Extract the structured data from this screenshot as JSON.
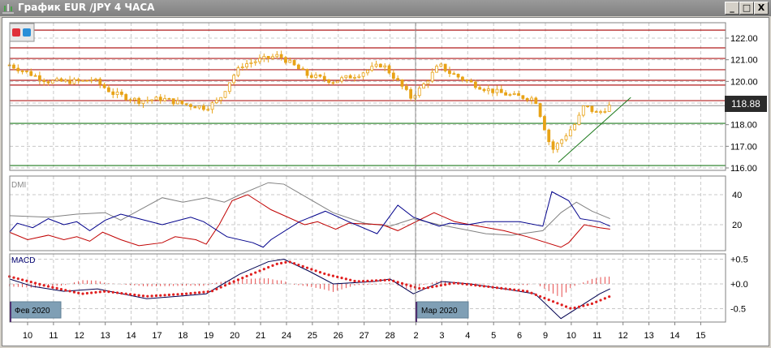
{
  "window": {
    "title": "График EUR /JPY  4 ЧАСА",
    "minimize": "_",
    "maximize": "□",
    "close": "X"
  },
  "colors": {
    "candle": "#e8a317",
    "resistance": "#b01c1c",
    "support": "#1d7a1d",
    "plus_di": "#00008b",
    "minus_di": "#c00000",
    "adx": "#808080",
    "macd": "#000050",
    "signal": "#e02020",
    "month_label_bg": "#7f9fb5",
    "price_tag_bg": "#2b2b2b"
  },
  "price_axis": {
    "ticks": [
      "122.00",
      "121.00",
      "120.00",
      "119.00",
      "118.00",
      "117.00",
      "116.00"
    ],
    "current_price": "118.88"
  },
  "dmi": {
    "label": "DMI",
    "ticks": [
      "40",
      "20"
    ]
  },
  "macd": {
    "label": "MACD",
    "ticks": [
      "+0.5",
      "+0.0",
      "-0.5"
    ]
  },
  "month_labels": [
    "Фев 2020",
    "Мар 2020"
  ],
  "date_ticks": [
    "10",
    "11",
    "12",
    "13",
    "14",
    "17",
    "18",
    "19",
    "20",
    "21",
    "24",
    "25",
    "26",
    "27",
    "28",
    "2",
    "3",
    "4",
    "5",
    "6",
    "9",
    "10",
    "11",
    "12",
    "13",
    "14",
    "15"
  ],
  "chart_data": {
    "type": "line",
    "title": "EUR/JPY 4H",
    "x_unit": "trading-day index (0 = 10 Feb)",
    "price": {
      "ylim": [
        115.8,
        122.6
      ],
      "close": [
        [
          -0.7,
          120.76
        ],
        [
          0.2,
          120.3
        ],
        [
          0.8,
          120.0
        ],
        [
          2.1,
          120.0
        ],
        [
          2.5,
          120.1
        ],
        [
          3.3,
          119.45
        ],
        [
          4.3,
          119.1
        ],
        [
          5.2,
          119.2
        ],
        [
          6.0,
          118.96
        ],
        [
          6.9,
          118.78
        ],
        [
          7.4,
          119.15
        ],
        [
          7.9,
          120.2
        ],
        [
          8.3,
          120.76
        ],
        [
          9.0,
          121.0
        ],
        [
          9.7,
          121.2
        ],
        [
          10.2,
          120.8
        ],
        [
          10.8,
          120.3
        ],
        [
          11.8,
          120.0
        ],
        [
          12.7,
          120.3
        ],
        [
          13.7,
          120.8
        ],
        [
          14.3,
          120.0
        ],
        [
          14.8,
          119.26
        ],
        [
          15.2,
          119.7
        ],
        [
          15.9,
          120.76
        ],
        [
          16.3,
          120.4
        ],
        [
          17.0,
          120.0
        ],
        [
          17.7,
          119.64
        ],
        [
          18.7,
          119.34
        ],
        [
          19.6,
          119.2
        ],
        [
          19.9,
          118.1
        ],
        [
          20.25,
          116.8
        ],
        [
          20.7,
          117.4
        ],
        [
          21.2,
          118.1
        ],
        [
          21.5,
          118.9
        ],
        [
          22.0,
          118.5
        ],
        [
          22.5,
          118.88
        ]
      ],
      "resistance_levels": [
        122.37,
        121.55,
        121.06,
        120.54,
        120.05,
        119.83,
        119.11
      ],
      "support_levels": [
        118.06,
        116.11
      ],
      "trendline": [
        [
          20.5,
          116.26
        ],
        [
          23.3,
          119.26
        ]
      ]
    },
    "dmi": {
      "ylim": [
        3,
        50
      ],
      "adx": [
        [
          -0.7,
          26
        ],
        [
          0.8,
          25
        ],
        [
          1.9,
          27
        ],
        [
          3.0,
          28
        ],
        [
          3.6,
          23
        ],
        [
          5.2,
          38
        ],
        [
          6.0,
          35
        ],
        [
          6.9,
          38
        ],
        [
          7.6,
          35
        ],
        [
          8.2,
          40
        ],
        [
          9.3,
          48
        ],
        [
          9.9,
          47
        ],
        [
          10.8,
          38
        ],
        [
          11.8,
          28
        ],
        [
          13.0,
          21
        ],
        [
          14.0,
          19
        ],
        [
          14.9,
          24
        ],
        [
          15.9,
          20
        ],
        [
          16.8,
          17
        ],
        [
          17.7,
          14
        ],
        [
          18.7,
          13
        ],
        [
          19.9,
          16
        ],
        [
          20.6,
          28
        ],
        [
          21.2,
          35
        ],
        [
          21.8,
          29
        ],
        [
          22.5,
          24
        ]
      ],
      "plus_di": [
        [
          -0.7,
          15
        ],
        [
          -0.4,
          21
        ],
        [
          0.2,
          18
        ],
        [
          0.8,
          24
        ],
        [
          1.4,
          20
        ],
        [
          1.9,
          22
        ],
        [
          2.4,
          16
        ],
        [
          3.0,
          23
        ],
        [
          3.6,
          27
        ],
        [
          4.3,
          24
        ],
        [
          5.2,
          20
        ],
        [
          6.3,
          25
        ],
        [
          6.8,
          22
        ],
        [
          7.7,
          12
        ],
        [
          8.7,
          8
        ],
        [
          9.1,
          5
        ],
        [
          9.4,
          10
        ],
        [
          10.5,
          22
        ],
        [
          11.5,
          29
        ],
        [
          12.4,
          22
        ],
        [
          13.5,
          14
        ],
        [
          14.3,
          33
        ],
        [
          14.9,
          25
        ],
        [
          15.9,
          19
        ],
        [
          16.3,
          21
        ],
        [
          17.0,
          20
        ],
        [
          17.7,
          22
        ],
        [
          19.0,
          22
        ],
        [
          19.9,
          19
        ],
        [
          20.25,
          42
        ],
        [
          20.9,
          36
        ],
        [
          21.35,
          24
        ],
        [
          22.1,
          22
        ],
        [
          22.5,
          19
        ]
      ],
      "minus_di": [
        [
          -0.7,
          15
        ],
        [
          0.0,
          10
        ],
        [
          0.8,
          13
        ],
        [
          1.4,
          10
        ],
        [
          1.9,
          12
        ],
        [
          2.4,
          9
        ],
        [
          2.9,
          15
        ],
        [
          3.6,
          10
        ],
        [
          4.3,
          6
        ],
        [
          5.2,
          8
        ],
        [
          5.7,
          12
        ],
        [
          6.5,
          10
        ],
        [
          6.9,
          7
        ],
        [
          7.4,
          20
        ],
        [
          7.9,
          36
        ],
        [
          8.5,
          40
        ],
        [
          9.4,
          30
        ],
        [
          10.7,
          20
        ],
        [
          11.2,
          22
        ],
        [
          11.9,
          17
        ],
        [
          12.4,
          21
        ],
        [
          13.7,
          20
        ],
        [
          14.3,
          16
        ],
        [
          15.7,
          28
        ],
        [
          16.5,
          22
        ],
        [
          17.1,
          20
        ],
        [
          18.4,
          16
        ],
        [
          19.3,
          12
        ],
        [
          20.6,
          5
        ],
        [
          20.9,
          8
        ],
        [
          21.5,
          20
        ],
        [
          22.1,
          18
        ],
        [
          22.5,
          17
        ]
      ]
    },
    "macd": {
      "ylim": [
        -0.75,
        0.6
      ],
      "main": [
        [
          -0.7,
          0.1
        ],
        [
          0.2,
          -0.05
        ],
        [
          1.4,
          -0.15
        ],
        [
          2.7,
          -0.1
        ],
        [
          4.6,
          -0.3
        ],
        [
          5.8,
          -0.25
        ],
        [
          6.9,
          -0.2
        ],
        [
          8.2,
          0.2
        ],
        [
          9.3,
          0.45
        ],
        [
          9.9,
          0.5
        ],
        [
          10.9,
          0.25
        ],
        [
          11.8,
          0.0
        ],
        [
          13.4,
          0.05
        ],
        [
          14.0,
          0.1
        ],
        [
          14.9,
          -0.2
        ],
        [
          16.0,
          0.05
        ],
        [
          17.1,
          0.0
        ],
        [
          18.4,
          -0.1
        ],
        [
          19.6,
          -0.2
        ],
        [
          20.6,
          -0.7
        ],
        [
          21.5,
          -0.4
        ],
        [
          22.1,
          -0.2
        ],
        [
          22.5,
          -0.1
        ]
      ],
      "signal": [
        [
          -0.7,
          0.15
        ],
        [
          0.8,
          -0.05
        ],
        [
          2.1,
          -0.2
        ],
        [
          3.0,
          -0.15
        ],
        [
          4.6,
          -0.25
        ],
        [
          6.1,
          -0.2
        ],
        [
          7.1,
          -0.15
        ],
        [
          8.2,
          0.1
        ],
        [
          9.6,
          0.4
        ],
        [
          10.1,
          0.45
        ],
        [
          11.5,
          0.2
        ],
        [
          12.7,
          0.05
        ],
        [
          14.0,
          0.08
        ],
        [
          15.2,
          -0.1
        ],
        [
          16.5,
          0.02
        ],
        [
          17.7,
          -0.05
        ],
        [
          19.3,
          -0.15
        ],
        [
          21.0,
          -0.5
        ],
        [
          21.8,
          -0.4
        ],
        [
          22.5,
          -0.25
        ]
      ]
    }
  }
}
